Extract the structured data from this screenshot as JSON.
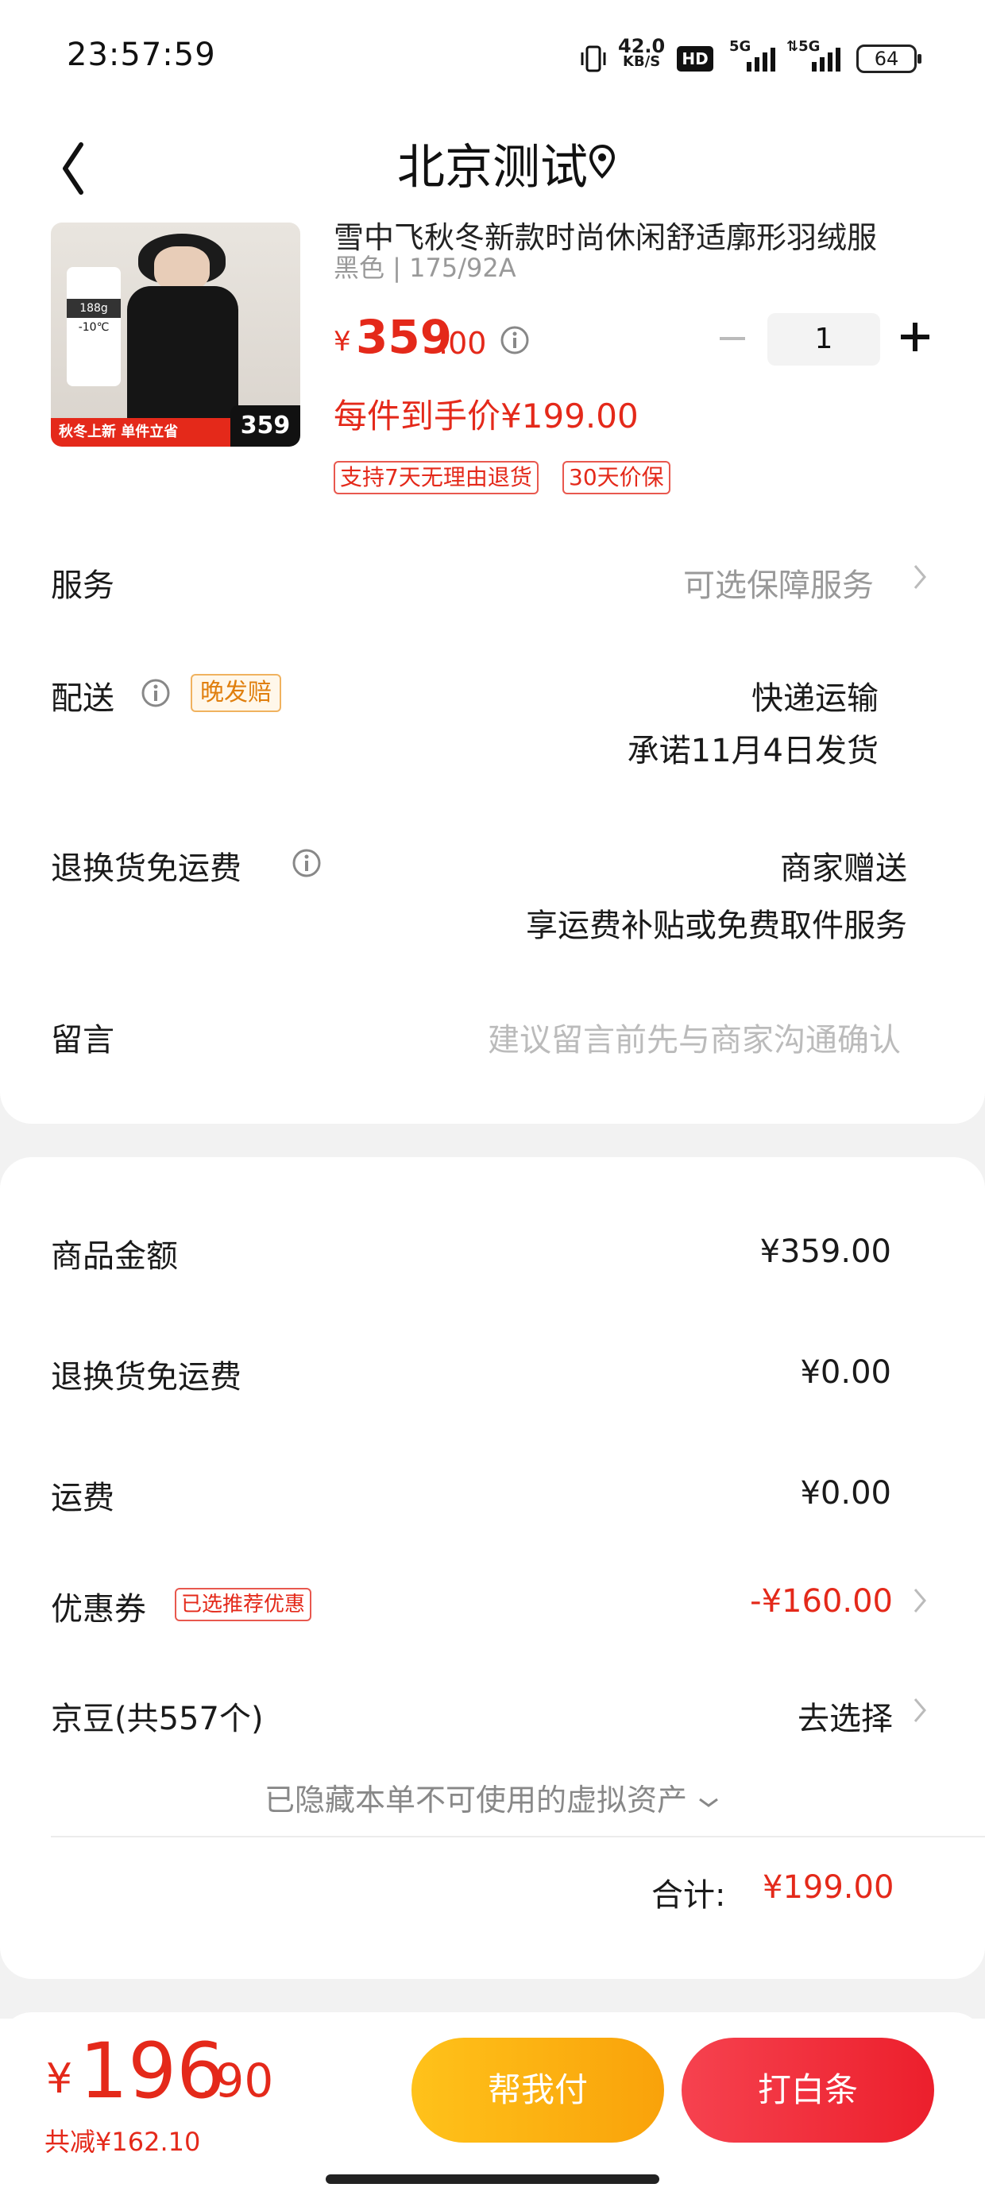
{
  "status_bar": {
    "time": "23:57:59",
    "net_speed": "42.0",
    "net_speed_unit": "KB/S",
    "hd_label": "HD",
    "signal1_label": "5G",
    "signal2_label": "5G",
    "battery": "64"
  },
  "header": {
    "title": "北京测试"
  },
  "product": {
    "title": "雪中飞秋冬新款时尚休闲舒适廓形羽绒服",
    "spec": "黑色 | 175/92A",
    "price_symbol": "¥",
    "price_main": "359",
    "price_decimal": ".00",
    "quantity": "1",
    "promo_price": "每件到手价¥199.00",
    "tags": [
      "支持7天无理由退货",
      "30天价保"
    ],
    "image_banner": "秋冬上新 单件立省",
    "image_price": "359",
    "image_badge": "-10℃",
    "image_stat": "188g"
  },
  "order_rows": {
    "service_label": "服务",
    "service_value": "可选保障服务",
    "delivery_label": "配送",
    "delivery_tag": "晚发赔",
    "delivery_value_1": "快递运输",
    "delivery_value_2": "承诺11月4日发货",
    "return_label": "退换货免运费",
    "return_value_1": "商家赠送",
    "return_value_2": "享运费补贴或免费取件服务",
    "message_label": "留言",
    "message_placeholder": "建议留言前先与商家沟通确认"
  },
  "summary": {
    "goods_amount_label": "商品金额",
    "goods_amount_value": "¥359.00",
    "return_fee_label": "退换货免运费",
    "return_fee_value": "¥0.00",
    "shipping_label": "运费",
    "shipping_value": "¥0.00",
    "coupon_label": "优惠券",
    "coupon_tag": "已选推荐优惠",
    "coupon_value": "-¥160.00",
    "jingdou_label": "京豆(共557个)",
    "jingdou_value": "去选择",
    "hidden_assets": "已隐藏本单不可使用的虚拟资产",
    "total_label": "合计:",
    "total_value": "¥199.00"
  },
  "bottom_bar": {
    "pay_symbol": "¥",
    "pay_main": "196",
    "pay_decimal": ".90",
    "pay_saving": "共减¥162.10",
    "help_pay_label": "帮我付",
    "baitiao_label": "打白条"
  },
  "colors": {
    "accent_red": "#e4291a",
    "button_yellow": "#fbb313",
    "button_red": "#ef2d39",
    "tag_orange": "#e07f0e"
  }
}
